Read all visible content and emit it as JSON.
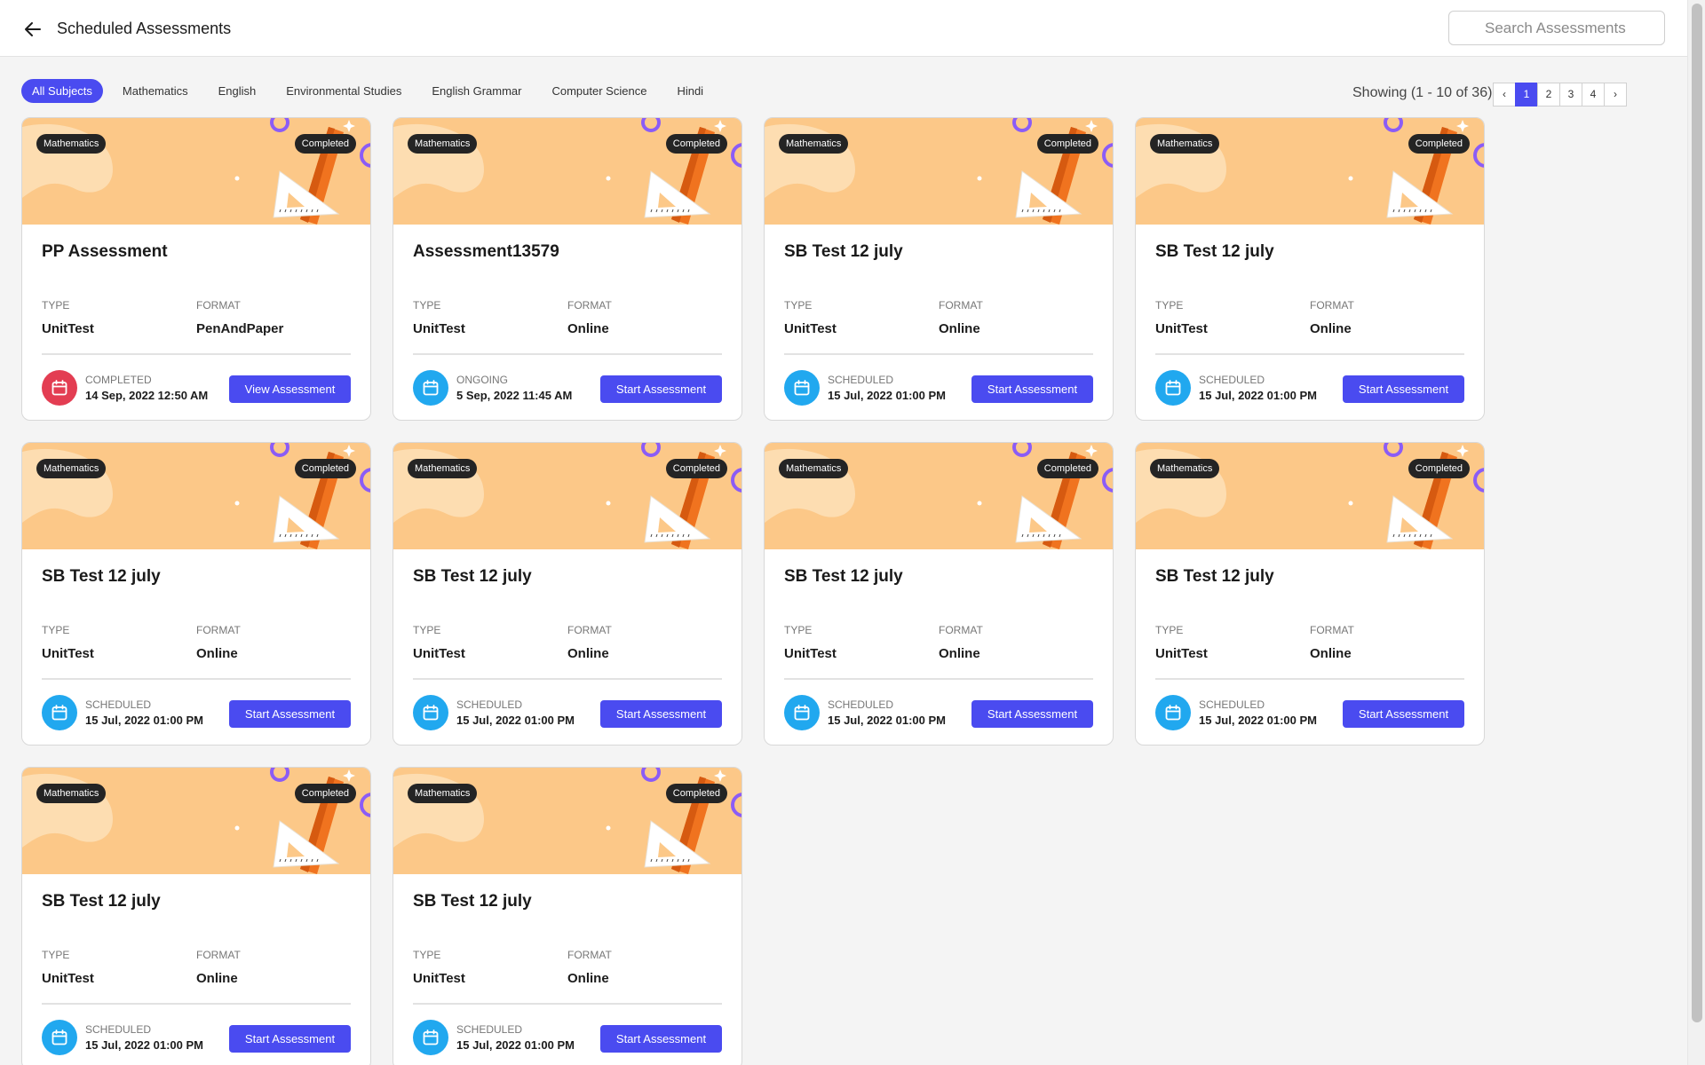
{
  "header": {
    "title": "Scheduled Assessments",
    "search_placeholder": "Search Assessments"
  },
  "filters": [
    "All Subjects",
    "Mathematics",
    "English",
    "Environmental Studies",
    "English Grammar",
    "Computer Science",
    "Hindi"
  ],
  "active_filter": "All Subjects",
  "pagination": {
    "showing": "Showing (1 - 10 of 36)",
    "prev": "‹",
    "next": "›",
    "pages": [
      "1",
      "2",
      "3",
      "4"
    ],
    "current": "1"
  },
  "labels": {
    "type": "TYPE",
    "format": "FORMAT"
  },
  "colors": {
    "accent": "#4a4bf0",
    "banner": "#fcc888",
    "calendar_scheduled": "#21a8ef",
    "calendar_completed": "#e33d52"
  },
  "cards": [
    {
      "subject": "Mathematics",
      "status": "Completed",
      "title": "PP Assessment",
      "type": "UnitTest",
      "format": "PenAndPaper",
      "state": "COMPLETED",
      "datetime": "14 Sep, 2022 12:50 AM",
      "action": "View Assessment",
      "icon": "calendar-icon",
      "icon_color": "red"
    },
    {
      "subject": "Mathematics",
      "status": "Completed",
      "title": "Assessment13579",
      "type": "UnitTest",
      "format": "Online",
      "state": "ONGOING",
      "datetime": "5 Sep, 2022 11:45 AM",
      "action": "Start Assessment",
      "icon": "calendar-icon",
      "icon_color": "blue"
    },
    {
      "subject": "Mathematics",
      "status": "Completed",
      "title": "SB Test 12 july",
      "type": "UnitTest",
      "format": "Online",
      "state": "SCHEDULED",
      "datetime": "15 Jul, 2022 01:00 PM",
      "action": "Start Assessment",
      "icon": "calendar-icon",
      "icon_color": "blue"
    },
    {
      "subject": "Mathematics",
      "status": "Completed",
      "title": "SB Test 12 july",
      "type": "UnitTest",
      "format": "Online",
      "state": "SCHEDULED",
      "datetime": "15 Jul, 2022 01:00 PM",
      "action": "Start Assessment",
      "icon": "calendar-icon",
      "icon_color": "blue"
    },
    {
      "subject": "Mathematics",
      "status": "Completed",
      "title": "SB Test 12 july",
      "type": "UnitTest",
      "format": "Online",
      "state": "SCHEDULED",
      "datetime": "15 Jul, 2022 01:00 PM",
      "action": "Start Assessment",
      "icon": "calendar-icon",
      "icon_color": "blue"
    },
    {
      "subject": "Mathematics",
      "status": "Completed",
      "title": "SB Test 12 july",
      "type": "UnitTest",
      "format": "Online",
      "state": "SCHEDULED",
      "datetime": "15 Jul, 2022 01:00 PM",
      "action": "Start Assessment",
      "icon": "calendar-icon",
      "icon_color": "blue"
    },
    {
      "subject": "Mathematics",
      "status": "Completed",
      "title": "SB Test 12 july",
      "type": "UnitTest",
      "format": "Online",
      "state": "SCHEDULED",
      "datetime": "15 Jul, 2022 01:00 PM",
      "action": "Start Assessment",
      "icon": "calendar-icon",
      "icon_color": "blue"
    },
    {
      "subject": "Mathematics",
      "status": "Completed",
      "title": "SB Test 12 july",
      "type": "UnitTest",
      "format": "Online",
      "state": "SCHEDULED",
      "datetime": "15 Jul, 2022 01:00 PM",
      "action": "Start Assessment",
      "icon": "calendar-icon",
      "icon_color": "blue"
    },
    {
      "subject": "Mathematics",
      "status": "Completed",
      "title": "SB Test 12 july",
      "type": "UnitTest",
      "format": "Online",
      "state": "SCHEDULED",
      "datetime": "15 Jul, 2022 01:00 PM",
      "action": "Start Assessment",
      "icon": "calendar-icon",
      "icon_color": "blue"
    },
    {
      "subject": "Mathematics",
      "status": "Completed",
      "title": "SB Test 12 july",
      "type": "UnitTest",
      "format": "Online",
      "state": "SCHEDULED",
      "datetime": "15 Jul, 2022 01:00 PM",
      "action": "Start Assessment",
      "icon": "calendar-icon",
      "icon_color": "blue"
    }
  ]
}
